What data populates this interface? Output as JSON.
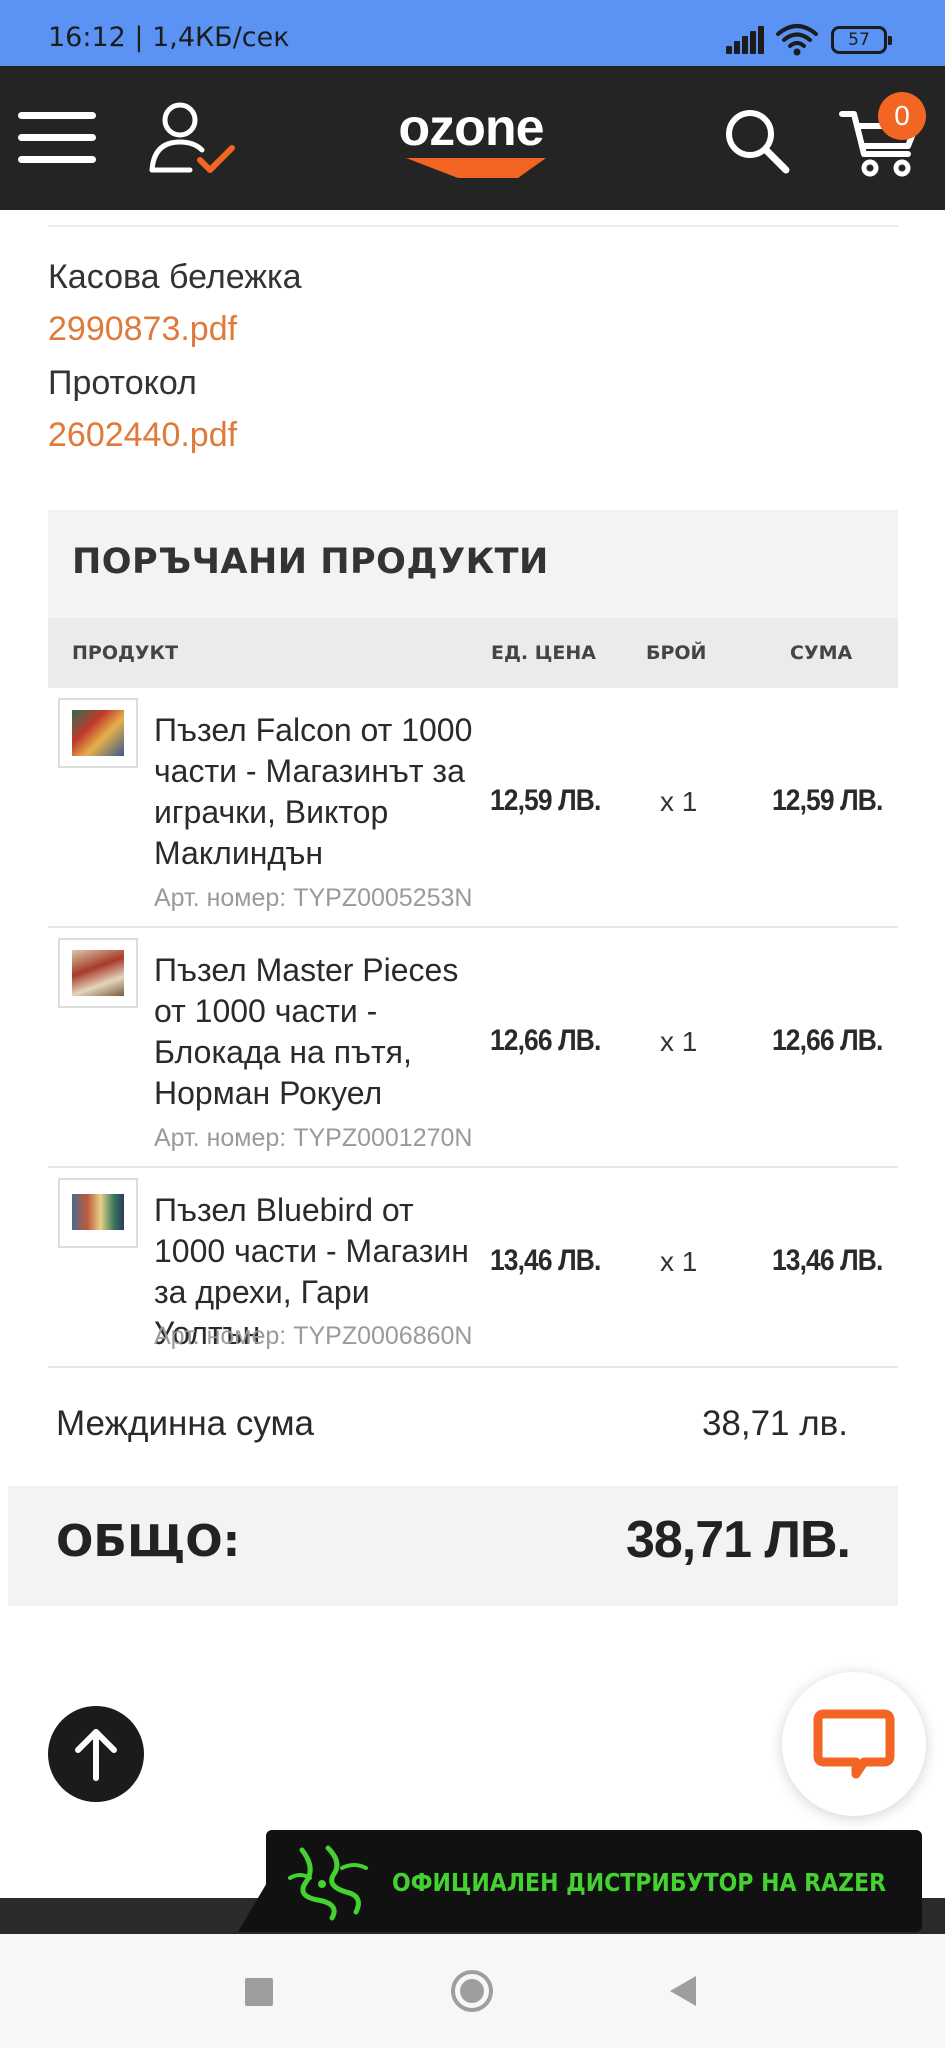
{
  "status_bar": {
    "time": "16:12 | 1,4КБ/сек",
    "battery": "57"
  },
  "header": {
    "logo_text": "ozone",
    "cart_count": "0",
    "brand_color": "#f26522",
    "icons": [
      "menu-icon",
      "user-check-icon",
      "search-icon",
      "cart-icon"
    ]
  },
  "documents": {
    "receipt_label": "Касова бележка",
    "receipt_file": "2990873.pdf",
    "protocol_label": "Протокол",
    "protocol_file": "2602440.pdf"
  },
  "ordered_products": {
    "title": "ПОРЪЧАНИ ПРОДУКТИ",
    "columns": {
      "product": "ПРОДУКТ",
      "unit_price": "ЕД. ЦЕНА",
      "qty": "БРОЙ",
      "sum": "СУМА"
    },
    "items": [
      {
        "name": "Пъзел Falcon от 1000 части - Магазинът за играчки, Виктор Маклиндън",
        "article": "Арт. номер: TYPZ0005253N",
        "unit_price": "12,59 ЛВ.",
        "qty": "x 1",
        "sum": "12,59 ЛВ."
      },
      {
        "name": "Пъзел Master Pieces от 1000 части - Блокада на пътя, Норман Рокуел",
        "article": "Арт. номер: TYPZ0001270N",
        "unit_price": "12,66 ЛВ.",
        "qty": "x 1",
        "sum": "12,66 ЛВ."
      },
      {
        "name": "Пъзел Bluebird от 1000 части - Магазин за дрехи, Гари Уолтън",
        "article": "Арт. номер: TYPZ0006860N",
        "unit_price": "13,46 ЛВ.",
        "qty": "x 1",
        "sum": "13,46 ЛВ."
      }
    ]
  },
  "totals": {
    "subtotal_label": "Междинна сума",
    "subtotal_value": "38,71 лв.",
    "total_label": "ОБЩО:",
    "total_value": "38,71 ЛВ."
  },
  "banner": {
    "text": "ОФИЦИАЛЕН  ДИСТРИБУТОР НА RAZER",
    "color": "#43d22f"
  },
  "link_color": "#e07a3a"
}
